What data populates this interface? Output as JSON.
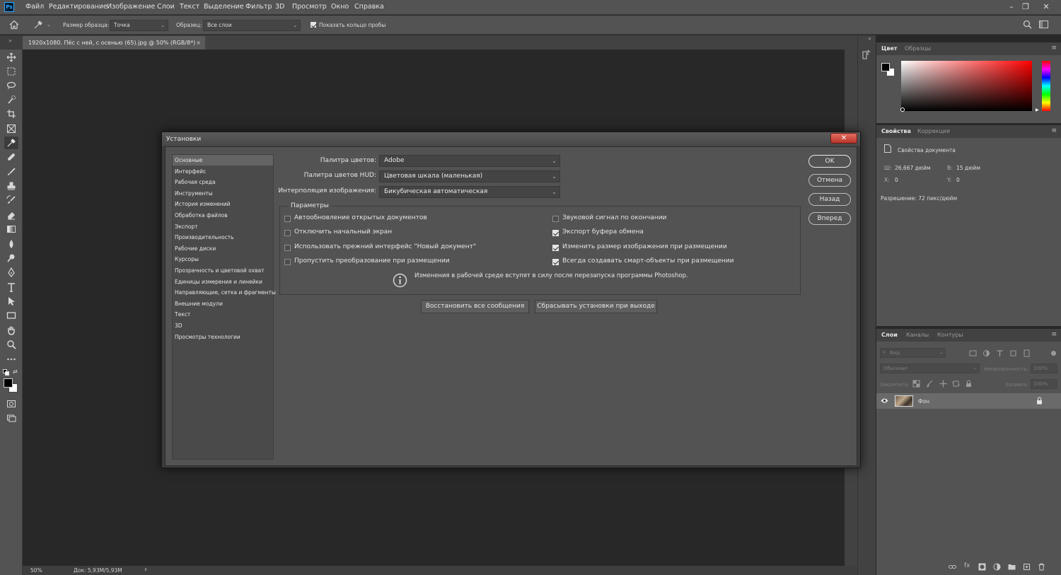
{
  "app": {
    "logo": "Ps"
  },
  "menu": [
    "Файл",
    "Редактирование",
    "Изображение",
    "Слои",
    "Текст",
    "Выделение",
    "Фильтр",
    "3D",
    "Просмотр",
    "Окно",
    "Справка"
  ],
  "window_controls": {
    "minimize": "–",
    "restore": "❐",
    "close": "✕"
  },
  "options_bar": {
    "sample_size_label": "Размер образца:",
    "sample_size_value": "Точка",
    "sample_label": "Образец:",
    "sample_value": "Все слои",
    "show_ring_label": "Показать кольцо пробы",
    "show_ring_checked": true
  },
  "document_tab": {
    "title": "1920x1080. Пёс с ней, с осенью (65).jpg @ 50% (RGB/8*)",
    "close": "×"
  },
  "status_bar": {
    "zoom": "50%",
    "doc": "Док: 5,93M/5,93M",
    "arrow": "›"
  },
  "color_panel": {
    "tabs": [
      "Цвет",
      "Образцы"
    ],
    "active_tab": 0,
    "fg_color": "#000000",
    "bg_color": "#ffffff",
    "hue": "#ff0000"
  },
  "properties_panel": {
    "tabs": [
      "Свойства",
      "Коррекция"
    ],
    "active_tab": 0,
    "section_title": "Свойства документа",
    "width_label": "Ш:",
    "width_value": "26,667 дюйм",
    "height_label": "В:",
    "height_value": "15 дюйм",
    "x_label": "X:",
    "x_value": "0",
    "y_label": "Y:",
    "y_value": "0",
    "resolution": "Разрешение: 72 пикс/дюйм"
  },
  "layers_panel": {
    "tabs": [
      "Слои",
      "Каналы",
      "Контуры"
    ],
    "active_tab": 0,
    "search_placeholder": "Вид",
    "blend_mode": "Обычные",
    "opacity_label": "Непрозрачность:",
    "opacity_value": "100%",
    "lock_label": "Закрепить:",
    "fill_label": "Заливка:",
    "fill_value": "100%",
    "layers": [
      {
        "name": "Фон",
        "visible": true,
        "locked": true
      }
    ]
  },
  "dialog": {
    "title": "Установки",
    "close": "✕",
    "nav": [
      "Основные",
      "Интерфейс",
      "Рабочая среда",
      "Инструменты",
      "История изменений",
      "Обработка файлов",
      "Экспорт",
      "Производительность",
      "Рабочие диски",
      "Курсоры",
      "Прозрачность и цветовой охват",
      "Единицы измерения и линейки",
      "Направляющие, сетка и фрагменты",
      "Внешние модули",
      "Текст",
      "3D",
      "Просмотры технологии"
    ],
    "nav_selected": 0,
    "fields": [
      {
        "label": "Палитра цветов:",
        "value": "Adobe"
      },
      {
        "label": "Палитра цветов HUD:",
        "value": "Цветовая шкала (маленькая)"
      },
      {
        "label": "Интерполяция изображения:",
        "value": "Бикубическая автоматическая"
      }
    ],
    "params_title": "Параметры",
    "checkboxes_left": [
      {
        "label": "Автообновление открытых документов",
        "checked": false
      },
      {
        "label": "Отключить начальный экран",
        "checked": false
      },
      {
        "label": "Использовать прежний интерфейс \"Новый документ\"",
        "checked": false
      },
      {
        "label": "Пропустить преобразование при размещении",
        "checked": false
      }
    ],
    "checkboxes_right": [
      {
        "label": "Звуковой сигнал по окончании",
        "checked": false
      },
      {
        "label": "Экспорт буфера обмена",
        "checked": true
      },
      {
        "label": "Изменить размер изображения при размещении",
        "checked": true
      },
      {
        "label": "Всегда создавать смарт-объекты при размещении",
        "checked": true
      }
    ],
    "info_text": "Изменения в рабочей среде вступят в силу после перезапуска программы Photoshop.",
    "restore_messages": "Восстановить все сообщения",
    "reset_on_exit": "Сбрасывать установки при выходе",
    "buttons": {
      "ok": "OK",
      "cancel": "Отмена",
      "back": "Назад",
      "forward": "Вперед"
    }
  }
}
